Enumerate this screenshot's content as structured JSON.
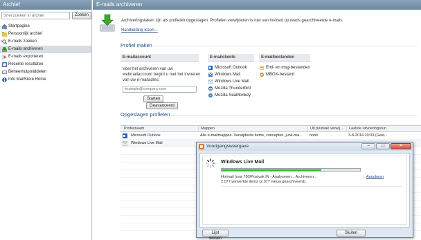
{
  "sidebar": {
    "title": "Archief",
    "search_placeholder": "Snel zoeken in archief",
    "search_button": "Zoeken",
    "items": [
      {
        "label": "Startpagina",
        "icon": "home-icon"
      },
      {
        "label": "Persoonlijk archief",
        "icon": "folder-icon"
      },
      {
        "label": "E-mails zoeken",
        "icon": "search-icon"
      },
      {
        "label": "E-mails archiveren",
        "icon": "archive-icon",
        "selected": true
      },
      {
        "label": "E-mails exporteren",
        "icon": "export-icon"
      },
      {
        "label": "Recente resultaten",
        "icon": "results-icon"
      },
      {
        "label": "Beheerhulpmiddelen",
        "icon": "tools-icon"
      },
      {
        "label": "Info MailStore Home",
        "icon": "info-icon"
      }
    ]
  },
  "main": {
    "title": "E-mails archiveren",
    "intro": "Archiveringstaken zijn als profielen opgeslagen. Profielen verwijderen is niet van invloed op reeds gearchiveerde e-mails.",
    "manual_link": "Handleiding lezen...",
    "profile_section": {
      "title": "Profiel maken",
      "mail_account": {
        "header": "E-mailaccount",
        "desc_lines": [
          "Voer het archiveren van uw",
          "webmailaccount begint u met het invoeren",
          "van uw e-mailadres:"
        ],
        "placeholder": "example@company.com",
        "start_button": "Starten",
        "advanced_button": "Geavanceerd"
      },
      "mail_clients": {
        "header": "E-mailclients",
        "items": [
          "Microsoft Outlook",
          "Windows Mail",
          "Windows Live Mail",
          "Mozilla Thunderbird",
          "Mozilla SeaMonkey"
        ]
      },
      "mail_files": {
        "header": "E-mailbestanden",
        "items": [
          "Eml- en msg-bestanden",
          "MBOX-bestand"
        ]
      }
    },
    "saved_section": {
      "title": "Opgeslagen profielen",
      "columns": [
        "Profielnaam",
        "Mappen",
        "Uit postvak verwij...",
        "Laatste uitvoeringsrun"
      ],
      "rows": [
        {
          "name": "Microsoft Outlook",
          "folders": "Alle e-mailmappen. Verwijderde items, concepten, junk-ma...",
          "delete": "nooit",
          "last_run": "3-8-2014 20:03 (Gesl..."
        },
        {
          "name": "Windows Live Mail",
          "folders": "",
          "delete": "",
          "last_run": ""
        }
      ]
    }
  },
  "dialog": {
    "title": "Voortgangsweergave",
    "job_title": "Windows Live Mail",
    "progress": 0.72,
    "status": "Hotmail (nsa 780/Postvak IN - Analyseren... Archiveren...",
    "cancel_link": "Annuleren",
    "count": "2.077 verwerkte items (2.077 nieuw gearchiveerd).",
    "clear_button": "Lijst wissen",
    "close_button": "Sluiten",
    "win_min": "–",
    "win_max": "▭",
    "win_close": "✕"
  }
}
